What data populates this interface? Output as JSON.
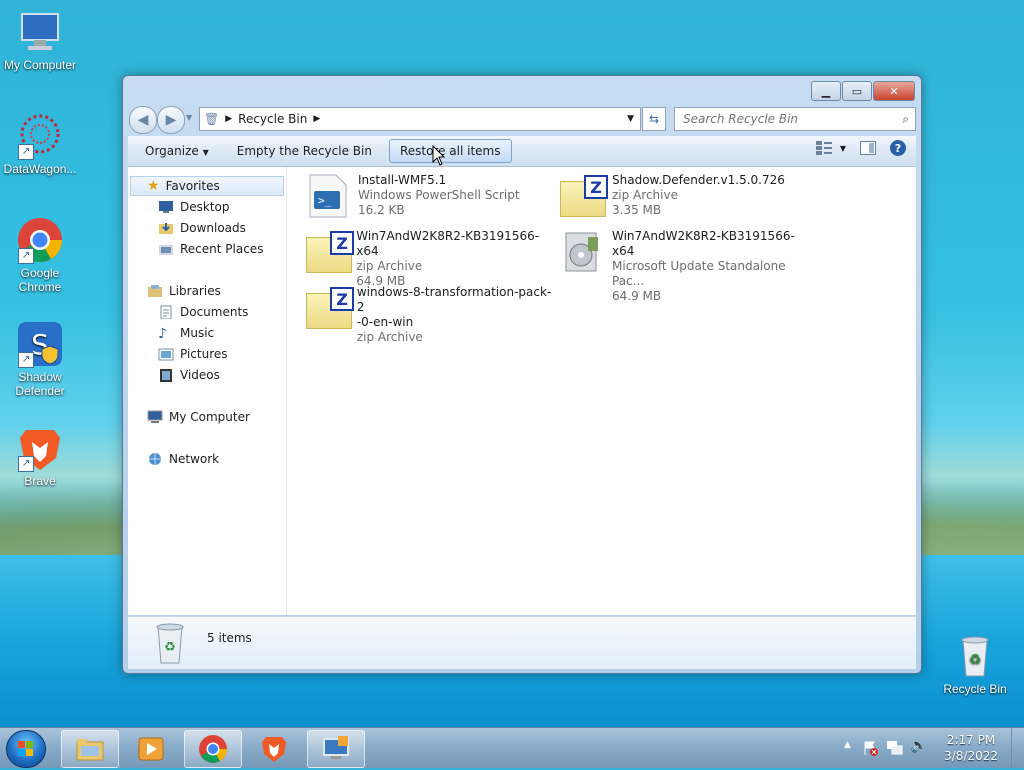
{
  "desktop": {
    "icons": [
      {
        "label": "My Computer"
      },
      {
        "label": "DataWagon..."
      },
      {
        "label": "Google Chrome"
      },
      {
        "label": "Shadow Defender"
      },
      {
        "label": "Brave"
      },
      {
        "label": "Recycle Bin"
      }
    ]
  },
  "window": {
    "address": {
      "crumb": "Recycle Bin"
    },
    "search": {
      "placeholder": "Search Recycle Bin"
    },
    "toolbar": {
      "organize": "Organize",
      "empty": "Empty the Recycle Bin",
      "restore": "Restore all items",
      "help": "?"
    },
    "nav": {
      "favorites": "Favorites",
      "desktop": "Desktop",
      "downloads": "Downloads",
      "recent": "Recent Places",
      "libraries": "Libraries",
      "documents": "Documents",
      "music": "Music",
      "pictures": "Pictures",
      "videos": "Videos",
      "computer": "My Computer",
      "network": "Network"
    },
    "files": [
      {
        "name": "Install-WMF5.1",
        "type": "Windows PowerShell Script",
        "size": "16.2 KB"
      },
      {
        "name": "Shadow.Defender.v1.5.0.726",
        "type": "zip Archive",
        "size": "3.35 MB"
      },
      {
        "name": "Win7AndW2K8R2-KB3191566-x64",
        "type": "zip Archive",
        "size": "64.9 MB"
      },
      {
        "name": "Win7AndW2K8R2-KB3191566-x64",
        "type": "Microsoft Update Standalone Pac...",
        "size": "64.9 MB"
      },
      {
        "name": "windows-8-transformation-pack-2",
        "name2": "-0-en-win",
        "type": "zip Archive"
      }
    ],
    "status": {
      "count": "5 items"
    }
  },
  "taskbar": {
    "time": "2:17 PM",
    "date": "3/8/2022"
  }
}
